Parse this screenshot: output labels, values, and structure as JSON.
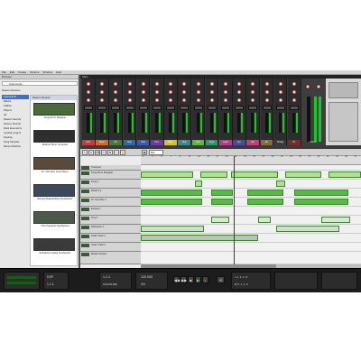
{
  "menubar": {
    "items": [
      "File",
      "Edit",
      "Create",
      "Options",
      "Window",
      "Help"
    ]
  },
  "browser": {
    "header": "Browser",
    "search_value": "Instruments",
    "places_title": "Reason Devices",
    "categories": [
      "Instruments",
      "Effects",
      "Utilities",
      "Players",
      "All",
      "Reason Sounds",
      "Factory Sounds",
      "Rack Extensions",
      "myshelf_prngmt",
      "Desktop",
      "Song Samples",
      "Recent Patches"
    ],
    "column_header": "Reason Devices",
    "devices": [
      "Kong Drum Designer",
      "Redrum Drum Computer",
      "Dr. Octo Rex Loop Player",
      "Europa Shapeshifting Synthesizer",
      "Thor Polysonic Synthesizer",
      "Subtractor Analog Synthesizer"
    ],
    "device_colors": [
      "#4a6a3a",
      "#2f2f2f",
      "#5a4a3a",
      "#3a4a5a",
      "#4a5a4a",
      "#3a3a3a"
    ]
  },
  "mixer": {
    "title": "Main",
    "channels": [
      "Kick",
      "Snare",
      "HH",
      "Clap",
      "Toms",
      "Perc",
      "Bass",
      "Sub",
      "Pad",
      "Keys",
      "Lead",
      "Arp",
      "Vox",
      "Gtr",
      "Strings",
      "FX"
    ],
    "channel_colors": [
      "#c43c3c",
      "#d06a2c",
      "#4a7a3a",
      "#2a6aa8",
      "#3a5ab8",
      "#6a3aa8",
      "#d0c22c",
      "#3a8a8a",
      "#5ab83a",
      "#2a9a6a",
      "#b83a8a",
      "#4a4a9a",
      "#c43c7a",
      "#8a6a3a",
      "#3a3a3a",
      "#7a2a2a"
    ],
    "master_label": "Master"
  },
  "sequencer": {
    "snap_label": "Bar",
    "ruler": [
      "1",
      "3",
      "5",
      "7",
      "9",
      "11",
      "13",
      "15",
      "17",
      "19",
      "21",
      "23",
      "25",
      "27",
      "29",
      "31",
      "33",
      "35",
      "37",
      "39",
      "41",
      "43",
      "45",
      "47"
    ],
    "tracks": [
      "Transport",
      "Kong Drum Designer",
      "Kong 1",
      "Redrum 1",
      "Dr. Octo Rex 1",
      "Europa 1",
      "Thor 1",
      "Subtractor 1",
      "Audio Track 1",
      "Audio Track 2",
      "Master Section"
    ]
  },
  "transport": {
    "position_label": "1.1.1.",
    "time_label": "0:00:00:000",
    "bars": "1.1.1.",
    "tempo": "120.000",
    "signature": "4/4",
    "left_loc": "L  1. 1. 1. 0",
    "right_loc": "R  5. 1. 1. 0",
    "cpu_label": "DSP",
    "play_glyph": "▶",
    "stop_glyph": "■",
    "rec_glyph": "●",
    "rew_glyph": "◀◀",
    "ffw_glyph": "▶▶",
    "loop_glyph": "⟲"
  }
}
